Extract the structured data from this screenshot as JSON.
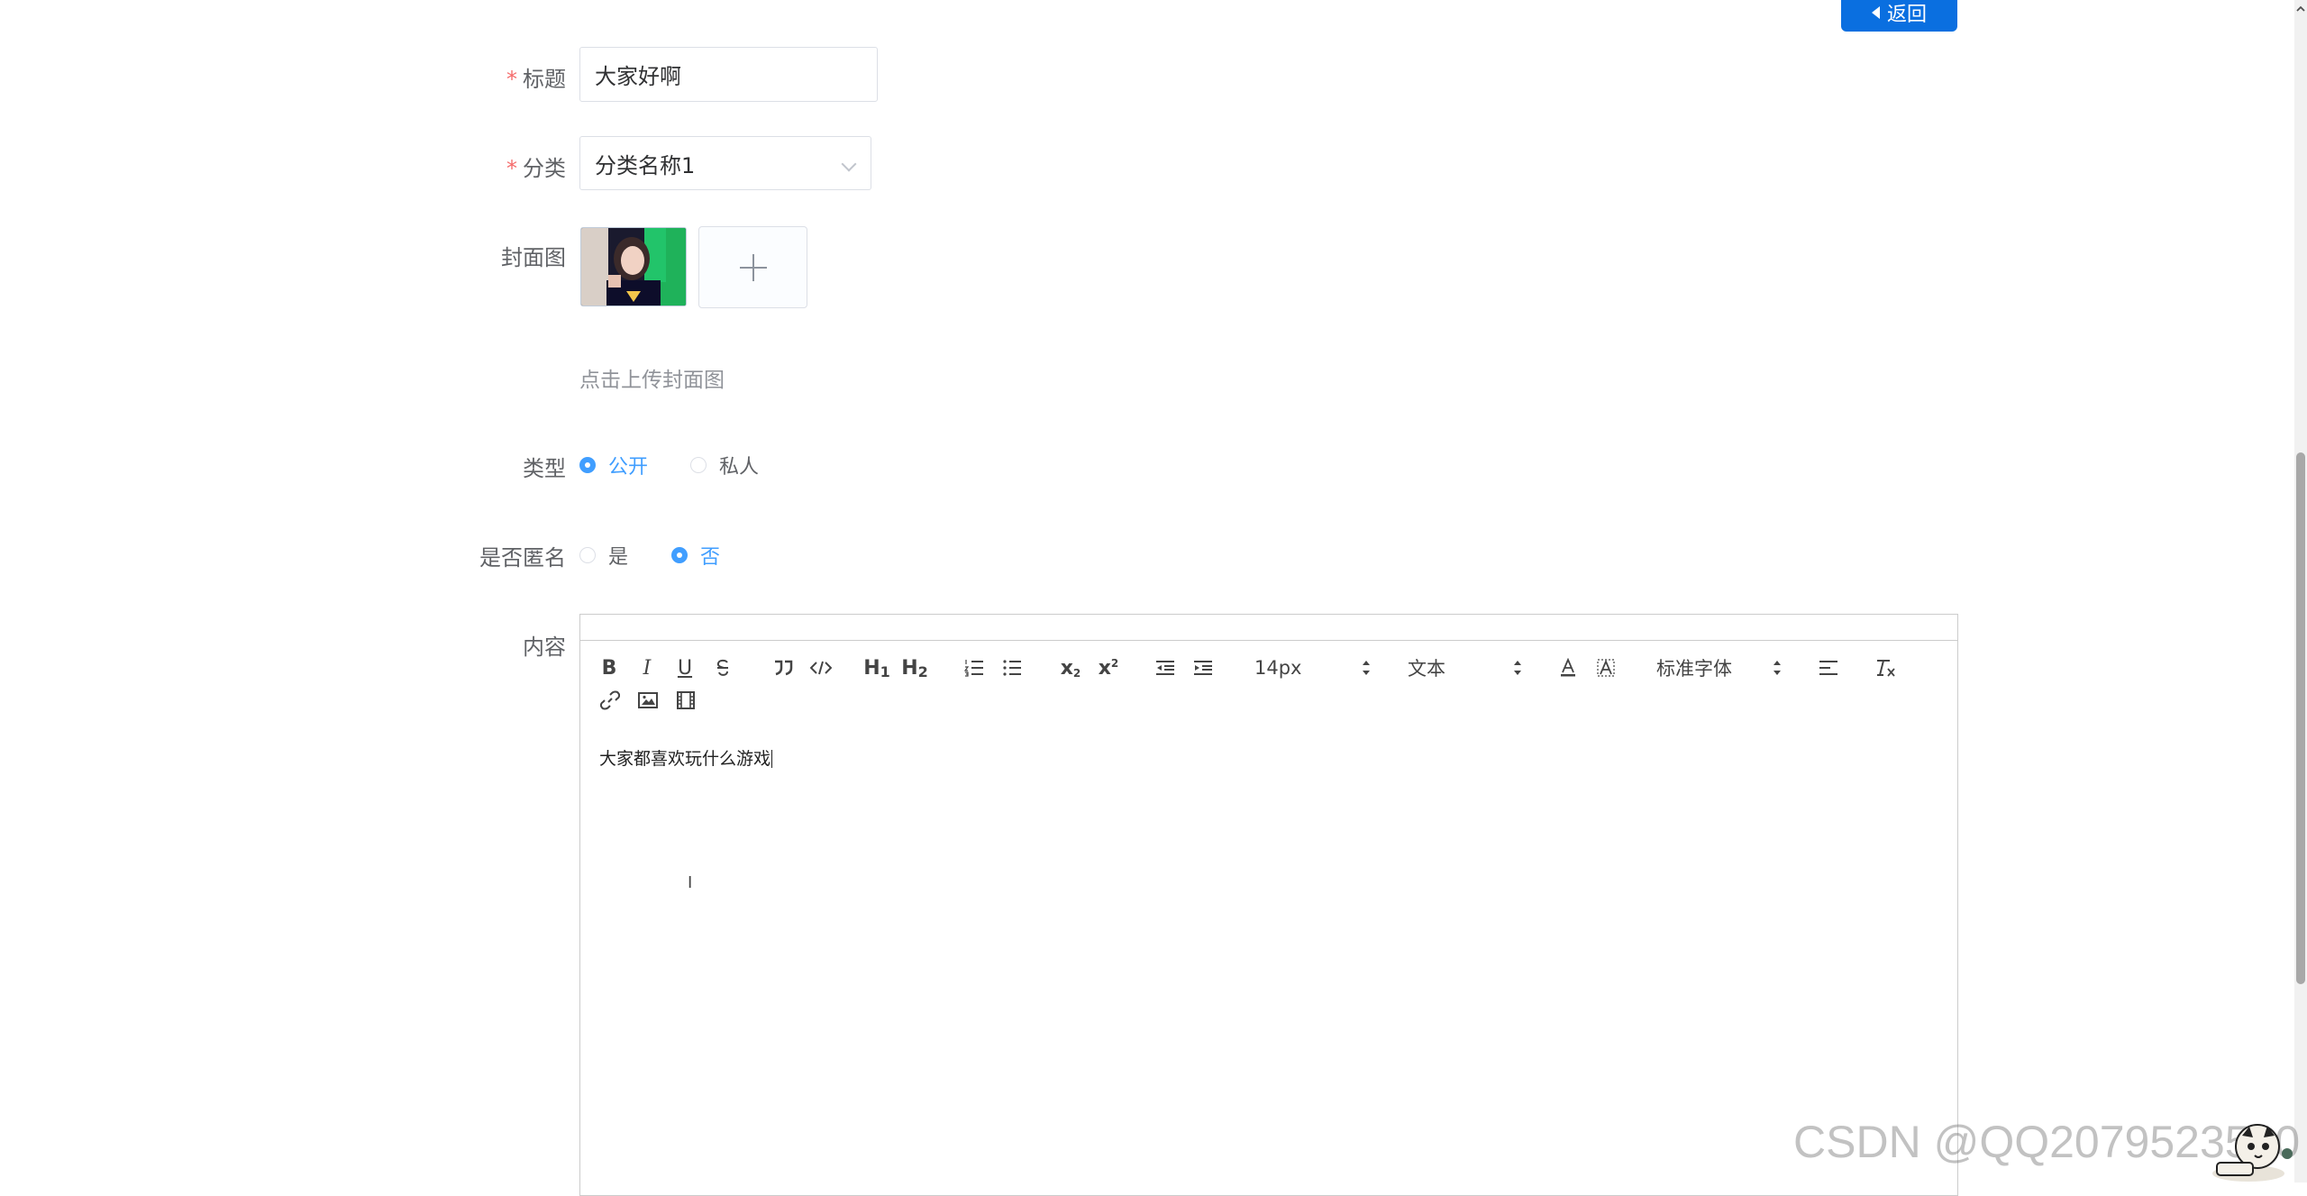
{
  "header": {
    "back_label": "返回"
  },
  "form": {
    "title": {
      "label": "标题",
      "required_mark": "*",
      "value": "大家好啊"
    },
    "category": {
      "label": "分类",
      "required_mark": "*",
      "value": "分类名称1"
    },
    "cover": {
      "label": "封面图",
      "hint": "点击上传封面图"
    },
    "type": {
      "label": "类型",
      "options": [
        "公开",
        "私人"
      ],
      "selected": "公开"
    },
    "anonymous": {
      "label": "是否匿名",
      "options": [
        "是",
        "否"
      ],
      "selected": "否"
    },
    "content": {
      "label": "内容"
    }
  },
  "editor": {
    "size_picker": "14px",
    "header_picker": "文本",
    "font_picker": "标准字体",
    "subscript_label": "x",
    "subscript_mark": "2",
    "superscript_label": "x",
    "superscript_mark": "2",
    "h1_label": "H",
    "h1_num": "1",
    "h2_label": "H",
    "h2_num": "2",
    "bold_label": "B",
    "italic_label": "I",
    "underline_label": "U",
    "body_text": "大家都喜欢玩什么游戏"
  },
  "watermark": "CSDN @QQ2079523510",
  "colors": {
    "primary": "#409eff",
    "button": "#0a6fe0",
    "required": "#f56c6c"
  }
}
